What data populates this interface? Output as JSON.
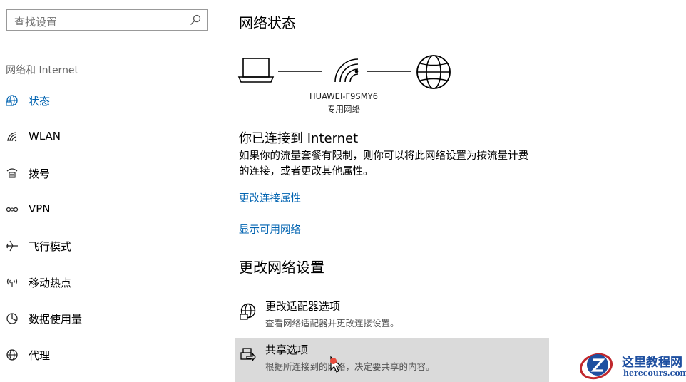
{
  "search": {
    "placeholder": "查找设置"
  },
  "sidebar": {
    "section_title": "网络和 Internet",
    "items": [
      {
        "label": "状态",
        "icon": "home-icon",
        "active": true
      },
      {
        "label": "WLAN",
        "icon": "wifi-icon"
      },
      {
        "label": "拨号",
        "icon": "dialup-icon"
      },
      {
        "label": "VPN",
        "icon": "vpn-icon"
      },
      {
        "label": "飞行模式",
        "icon": "airplane-icon"
      },
      {
        "label": "移动热点",
        "icon": "hotspot-icon"
      },
      {
        "label": "数据使用量",
        "icon": "data-usage-icon"
      },
      {
        "label": "代理",
        "icon": "globe-icon"
      }
    ]
  },
  "main": {
    "title": "网络状态",
    "network": {
      "name": "HUAWEI-F9SMY6",
      "type": "专用网络"
    },
    "status_heading": "你已连接到 Internet",
    "status_desc": "如果你的流量套餐有限制，则你可以将此网络设置为按流量计费的连接，或者更改其他属性。",
    "links": {
      "change_properties": "更改连接属性",
      "show_networks": "显示可用网络"
    },
    "change_settings_heading": "更改网络设置",
    "options": [
      {
        "title": "更改适配器选项",
        "desc": "查看网络适配器并更改连接设置。",
        "icon": "adapter-globe-icon"
      },
      {
        "title": "共享选项",
        "desc": "根据所连接到的网络，决定要共享的内容。",
        "icon": "sharing-icon"
      }
    ]
  },
  "watermark": {
    "title": "这里教程网",
    "url": "herecours.com"
  },
  "colors": {
    "accent": "#0063b1",
    "hover_bg": "#dadada",
    "watermark": "#1e4fa0"
  }
}
